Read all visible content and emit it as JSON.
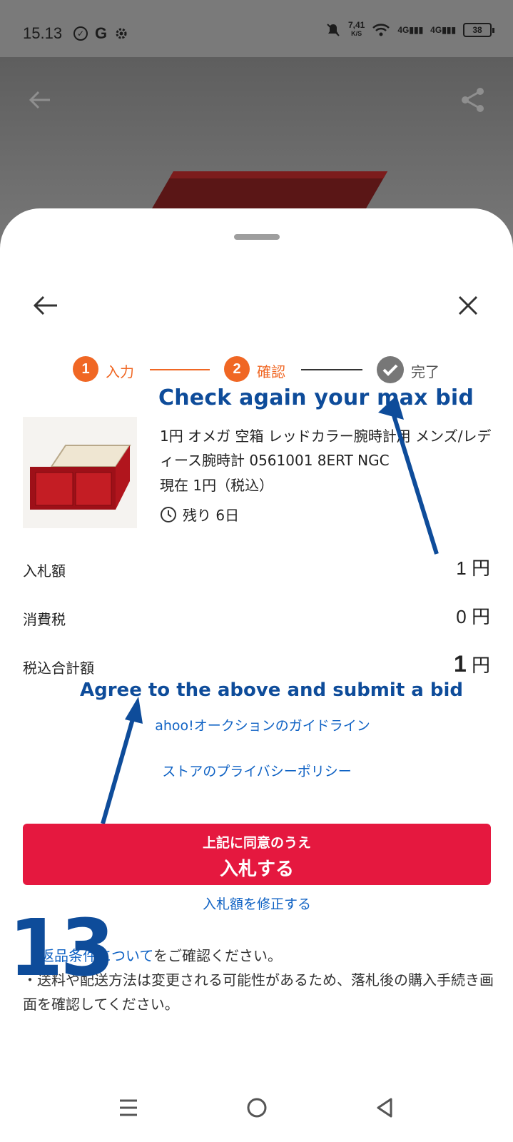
{
  "status_bar": {
    "time": "15.13",
    "speed_value": "7,41",
    "speed_unit": "K/S",
    "signal1": "4G",
    "signal2": "4G",
    "battery": "38"
  },
  "steps": [
    {
      "number": "1",
      "label": "入力"
    },
    {
      "number": "2",
      "label": "確認"
    },
    {
      "label": "完了"
    }
  ],
  "annotations": {
    "top": "Check again your max bid",
    "bottom": "Agree to the above and submit a bid",
    "step_number": "13"
  },
  "product": {
    "title": "1円 オメガ 空箱 レッドカラー腕時計用 メンズ/レディース腕時計 0561001 8ERT NGC",
    "current_price": "現在 1円（税込）",
    "remaining": "残り 6日"
  },
  "summary": {
    "bid_label": "入札額",
    "bid_value": "1",
    "tax_label": "消費税",
    "tax_value": "0",
    "total_label": "税込合計額",
    "total_value": "1",
    "currency": "円"
  },
  "links": {
    "guidelines": "ahoo!オークションのガイドライン",
    "privacy": "ストアのプライバシーポリシー",
    "edit_bid": "入札額を修正する"
  },
  "bid_button": {
    "sub": "上記に同意のうえ",
    "main": "入札する"
  },
  "notes": {
    "returns_link": "返品条件について",
    "returns_text": "をご確認ください。",
    "shipping": "・送料や配送方法は変更される可能性があるため、落札後の購入手続き画面を確認してください。"
  },
  "colors": {
    "accent_orange": "#f06724",
    "bid_button_red": "#e5183f",
    "link_blue": "#0f62c4",
    "annotation_blue": "#0e4c9a"
  }
}
